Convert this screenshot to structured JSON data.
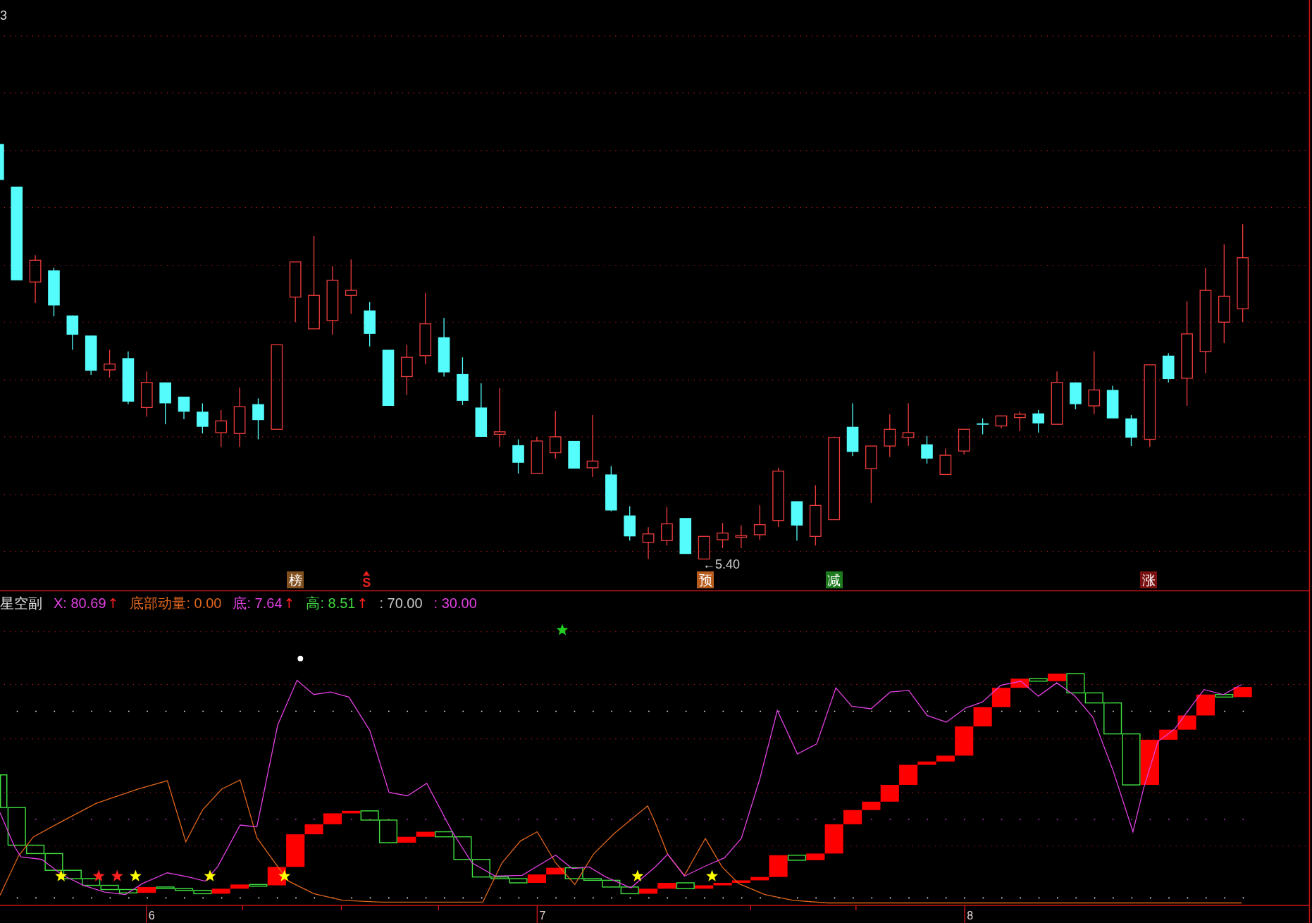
{
  "price_chart": {
    "axis_label": "3",
    "low_price_marker": "←5.40",
    "signal_markers": [
      {
        "text": "榜",
        "kind": "tile",
        "color": "#82501e"
      },
      {
        "text": "S",
        "kind": "arrow-letter",
        "color": "#e82020"
      },
      {
        "text": "预",
        "kind": "tile",
        "color": "#b85c1e"
      },
      {
        "text": "减",
        "kind": "tile",
        "color": "#1e7a1e"
      },
      {
        "text": "涨",
        "kind": "tile",
        "color": "#7a1010"
      }
    ]
  },
  "indicator_panel": {
    "title": "星空副",
    "readouts": [
      {
        "text": "X: 80.69",
        "color": "#e040e0",
        "arrow": "↑"
      },
      {
        "text": "底部动量: 0.00",
        "color": "#e0661c"
      },
      {
        "text": "底: 7.64",
        "color": "#e040e0",
        "arrow": "↑"
      },
      {
        "text": "高: 8.51",
        "color": "#40d840",
        "arrow": "↑"
      },
      {
        "text": ": 70.00",
        "color": "#c8c8c8"
      },
      {
        "text": ": 30.00",
        "color": "#e040e0"
      }
    ]
  },
  "time_axis": {
    "labels": [
      "6",
      "7",
      "8"
    ]
  }
}
